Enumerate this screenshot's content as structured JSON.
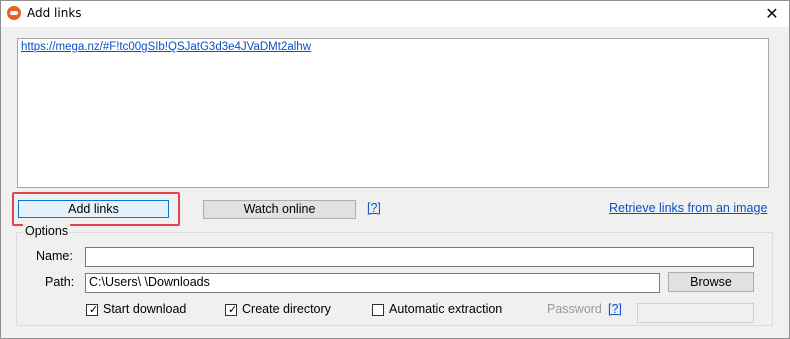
{
  "window": {
    "title": "Add links",
    "close_glyph": "✕",
    "app_icon": "mega-cloud-icon"
  },
  "links": {
    "text": "https://mega.nz/#F!tc00gSIb!QSJatG3d3e4JVaDMt2alhw"
  },
  "buttons": {
    "add_links": "Add links",
    "watch_online": "Watch online",
    "help": "[?]",
    "retrieve_links": "Retrieve links from an image",
    "browse": "Browse"
  },
  "options": {
    "legend": "Options",
    "name_label": "Name:",
    "name_value": "",
    "path_label": "Path:",
    "path_value": "C:\\Users\\           \\Downloads",
    "start_download": {
      "label": "Start download",
      "checked": true
    },
    "create_directory": {
      "label": "Create directory",
      "checked": true
    },
    "automatic_extraction": {
      "label": "Automatic extraction",
      "checked": false
    },
    "password_label": "Password",
    "password_help": "[?]",
    "password_value": ""
  },
  "colors": {
    "link": "#0a50c8",
    "highlight": "#e0444e",
    "app_icon": "#e8601c"
  }
}
